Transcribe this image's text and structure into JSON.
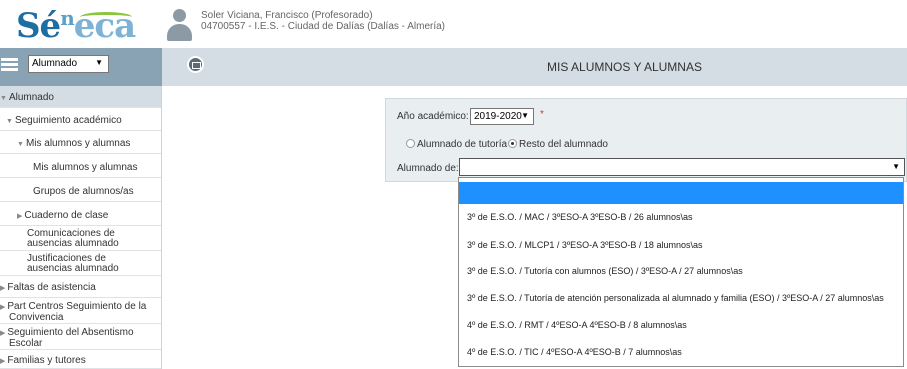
{
  "header": {
    "logo": {
      "part1": "Sé",
      "part2": "n",
      "part3": "eca"
    },
    "user_name": "Soler Viciana, Francisco (Profesorado)",
    "user_center": "04700557 - I.E.S. - Ciudad de Dalías (Dalías - Almería)"
  },
  "topbar": {
    "profile_value": "Alumnado",
    "page_title": "MIS ALUMNOS Y ALUMNAS"
  },
  "sidebar": {
    "items": [
      {
        "label": "Alumnado"
      },
      {
        "label": "Seguimiento académico"
      },
      {
        "label": "Mis alumnos y alumnas"
      },
      {
        "label": "Mis alumnos y alumnas"
      },
      {
        "label": "Grupos de alumnos/as"
      },
      {
        "label": "Cuaderno de clase"
      },
      {
        "label": "Comunicaciones de ausencias alumnado"
      },
      {
        "label": "Justificaciones de ausencias alumnado"
      },
      {
        "label": "Faltas de asistencia"
      },
      {
        "label": "Part Centros Seguimiento de la Convivencia"
      },
      {
        "label": "Seguimiento del Absentismo Escolar"
      },
      {
        "label": "Familias y tutores"
      }
    ]
  },
  "form": {
    "year_label": "Año académico:",
    "year_value": "2019-2020",
    "required_mark": "*",
    "radio_tutoria": "Alumnado de tutoría",
    "radio_resto": "Resto del alumnado",
    "alumnado_label": "Alumnado de:",
    "alumnado_value": ""
  },
  "dropdown": {
    "options": [
      "",
      "3º de E.S.O. / MAC / 3ºESO-A 3ºESO-B / 26 alumnos\\as",
      "3º de E.S.O. / MLCP1 / 3ºESO-A 3ºESO-B / 18 alumnos\\as",
      "3º de E.S.O. / Tutoría con alumnos (ESO) / 3ºESO-A / 27 alumnos\\as",
      "3º de E.S.O. / Tutoría de atención personalizada al alumnado y familia (ESO) / 3ºESO-A / 27 alumnos\\as",
      "4º de E.S.O. / RMT / 4ºESO-A 4ºESO-B / 8 alumnos\\as",
      "4º de E.S.O. / TIC / 4ºESO-A 4ºESO-B / 7 alumnos\\as"
    ]
  }
}
